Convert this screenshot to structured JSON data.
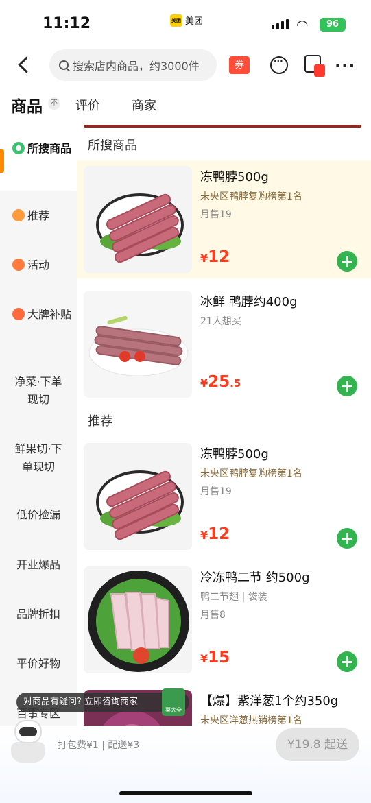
{
  "status_bar": {
    "time": "11:12",
    "app_name": "美团",
    "battery": "96"
  },
  "nav": {
    "search_placeholder": "搜索店内商品，约3000件",
    "coupon_label": "券"
  },
  "tabs": [
    {
      "label": "商品"
    },
    {
      "label": "评价"
    },
    {
      "label": "商家"
    }
  ],
  "tab_badge": "不",
  "sidebar": {
    "items": [
      {
        "label": "所搜商品"
      },
      {
        "label": "推荐"
      },
      {
        "label": "活动"
      },
      {
        "label": "大牌补贴"
      },
      {
        "label": "净菜·下单现切"
      },
      {
        "label": "鲜果切·下单现切"
      },
      {
        "label": "低价捡漏"
      },
      {
        "label": "开业爆品"
      },
      {
        "label": "品牌折扣"
      },
      {
        "label": "平价好物"
      },
      {
        "label": "百事专区"
      }
    ]
  },
  "sections": {
    "searched": "所搜商品",
    "recommended": "推荐"
  },
  "products": [
    {
      "name": "冻鸭脖500g",
      "sub": "未央区鸭脖复购榜第1名",
      "sub2": "月售19",
      "price_symbol": "¥",
      "price_int": "12",
      "price_dec": ""
    },
    {
      "name": "冰鲜 鸭脖约400g",
      "sub": "21人想买",
      "sub2": "",
      "price_symbol": "¥",
      "price_int": "25",
      "price_dec": ".5"
    },
    {
      "name": "冻鸭脖500g",
      "sub": "未央区鸭脖复购榜第1名",
      "sub2": "月售19",
      "price_symbol": "¥",
      "price_int": "12",
      "price_dec": ""
    },
    {
      "name": "冷冻鸭二节 约500g",
      "sub": "鸭二节翅 | 袋装",
      "sub2": "月售8",
      "price_symbol": "¥",
      "price_int": "15",
      "price_dec": ""
    },
    {
      "name": "【爆】紫洋葱1个约350g",
      "sub": "未央区洋葱热销榜第1名",
      "sub2": "",
      "price_symbol": "",
      "price_int": "",
      "price_dec": ""
    }
  ],
  "tooltip": "对商品有疑问? 立即咨询商家",
  "veg_badge": "菜大全",
  "bottom": {
    "fees": "打包费¥1 | 配送¥3",
    "checkout": "¥19.8 起送"
  },
  "colors": {
    "accent_green": "#34b450",
    "price_red": "#ff3b1f",
    "brand_yellow": "#ffd100",
    "highlight_bg": "#fff9e6"
  }
}
